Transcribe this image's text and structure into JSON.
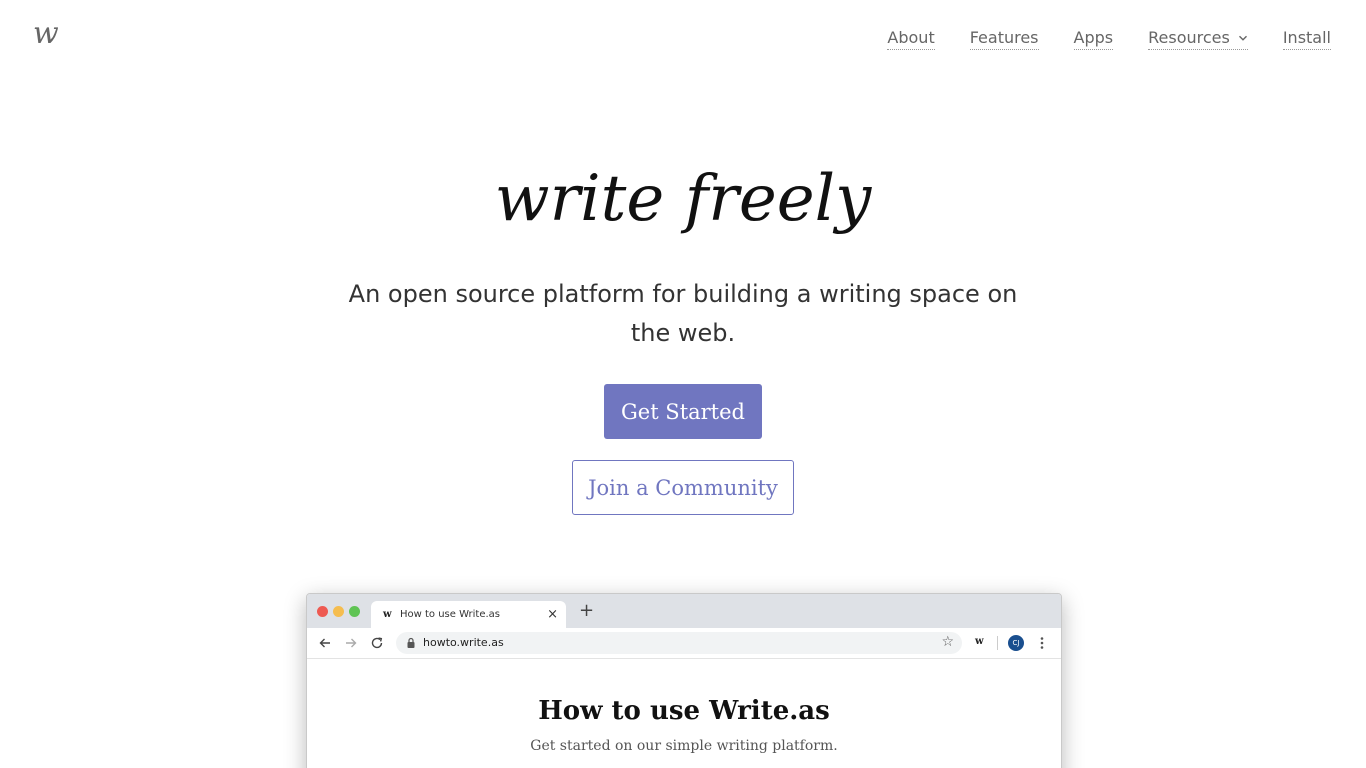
{
  "brand": {
    "logo_text": "w"
  },
  "nav": {
    "items": [
      {
        "label": "About"
      },
      {
        "label": "Features"
      },
      {
        "label": "Apps"
      },
      {
        "label": "Resources",
        "icon": "chevron-down-icon"
      },
      {
        "label": "Install"
      }
    ]
  },
  "hero": {
    "title": "write freely",
    "subtitle": "An open source platform for building a writing space on the web.",
    "primary_button": "Get Started",
    "secondary_button": "Join a Community"
  },
  "colors": {
    "accent": "#7076c0",
    "text": "#333333",
    "nav_text": "#666666"
  },
  "screenshot": {
    "tab_favicon": "w",
    "tab_title": "How to use Write.as",
    "tab_close": "×",
    "new_tab": "+",
    "url": "howto.write.as",
    "extension_label": "w",
    "avatar_initials": "CJ",
    "page_title": "How to use Write.as",
    "page_subtitle": "Get started on our simple writing platform."
  }
}
